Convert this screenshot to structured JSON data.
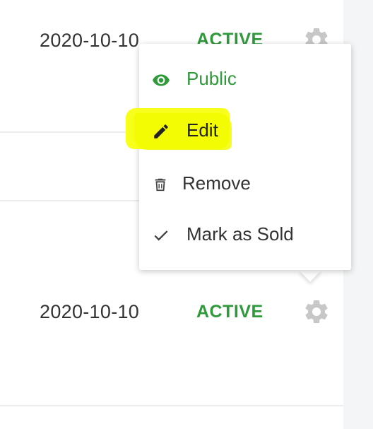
{
  "rows": [
    {
      "date": "2020-10-10",
      "status": "ACTIVE"
    },
    {
      "date": "2020-10-10",
      "status": "ACTIVE"
    }
  ],
  "menu": {
    "items": [
      {
        "label": "Public",
        "icon": "eye-icon"
      },
      {
        "label": "Edit",
        "icon": "pencil-icon"
      },
      {
        "label": "Remove",
        "icon": "trash-icon"
      },
      {
        "label": "Mark as Sold",
        "icon": "check-icon"
      }
    ]
  },
  "colors": {
    "status_green": "#2e9a3a",
    "highlight": "#f7ff1a",
    "gear_gray": "#c7c7c7",
    "text_dark": "#333333"
  }
}
